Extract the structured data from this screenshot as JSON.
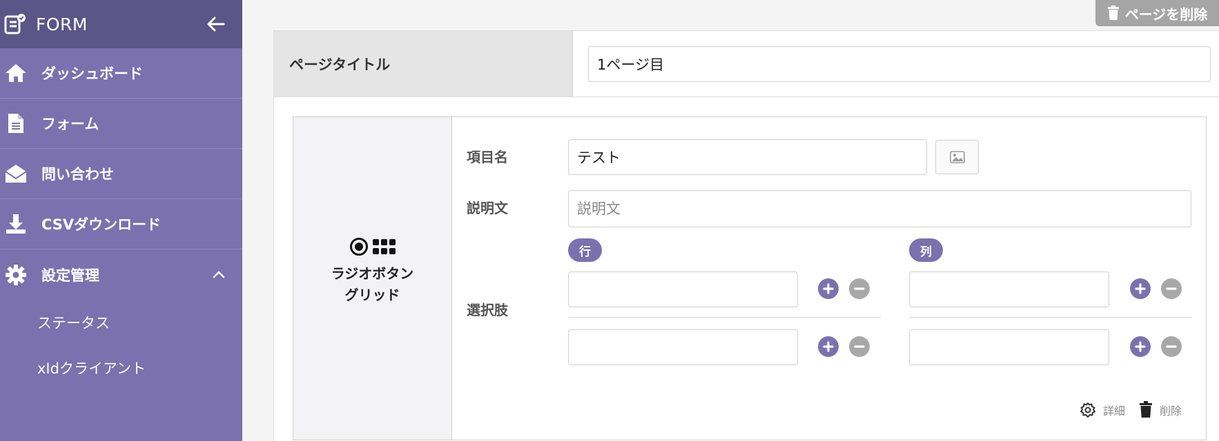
{
  "sidebar": {
    "app_title": "FORM",
    "nav": [
      {
        "label": "ダッシュボード",
        "icon": "home-icon"
      },
      {
        "label": "フォーム",
        "icon": "document-icon"
      },
      {
        "label": "問い合わせ",
        "icon": "envelope-icon"
      },
      {
        "label": "CSVダウンロード",
        "icon": "download-icon"
      },
      {
        "label": "設定管理",
        "icon": "gear-icon",
        "expanded": true
      }
    ],
    "sub_items": [
      {
        "label": "ステータス"
      },
      {
        "label": "xIdクライアント"
      }
    ]
  },
  "page": {
    "delete_label": "ページを削除",
    "title_label": "ページタイトル",
    "title_value": "1ページ目"
  },
  "question": {
    "type_label_line1": "ラジオボタン",
    "type_label_line2": "グリッド",
    "item_name_label": "項目名",
    "item_name_value": "テスト",
    "description_label": "説明文",
    "description_placeholder": "説明文",
    "choices_label": "選択肢",
    "rows_badge": "行",
    "columns_badge": "列",
    "detail_label": "詳細",
    "delete_label": "削除"
  },
  "colors": {
    "sidebar_bg": "#7b71ae",
    "sidebar_header_bg": "#5c5587",
    "accent": "#7b71ae",
    "muted_button": "#a5a5a5"
  }
}
